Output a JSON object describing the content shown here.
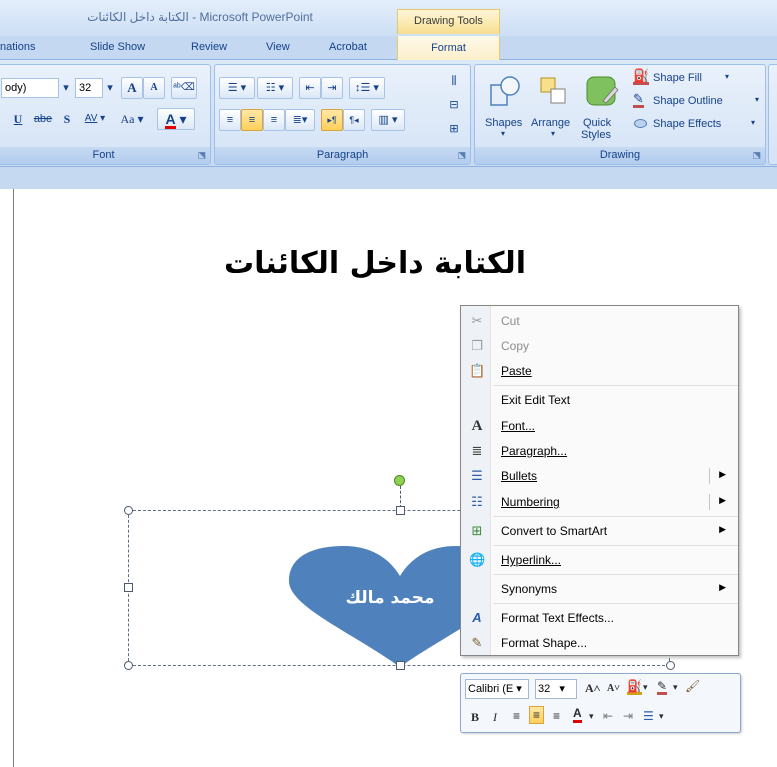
{
  "titlebar": {
    "title": "الكتابة داخل الكائنات - Microsoft PowerPoint",
    "contextual_header": "Drawing Tools"
  },
  "tabs": [
    {
      "label": "nations"
    },
    {
      "label": "Slide Show"
    },
    {
      "label": "Review"
    },
    {
      "label": "View"
    },
    {
      "label": "Acrobat"
    },
    {
      "label": "Format"
    }
  ],
  "ribbon": {
    "font": {
      "label": "Font",
      "font_name": "ody)",
      "font_size": "32",
      "grow": "A",
      "shrink": "A",
      "underline": "U",
      "strike": "abe",
      "shadow": "S",
      "spacing": "AV",
      "case": "Aa",
      "color": "A"
    },
    "paragraph": {
      "label": "Paragraph"
    },
    "drawing": {
      "label": "Drawing",
      "shapes": "Shapes",
      "arrange": "Arrange",
      "quick_styles_1": "Quick",
      "quick_styles_2": "Styles",
      "shape_fill": "Shape Fill",
      "shape_outline": "Shape Outline",
      "shape_effects": "Shape Effects"
    }
  },
  "slide": {
    "title": "الكتابة داخل الكائنات",
    "heart_text": "محمد مالك",
    "heart_color": "#4f81bd"
  },
  "context_menu": [
    {
      "label": "Cut",
      "hotkey_idx": 2,
      "disabled": true
    },
    {
      "label": "Copy",
      "disabled": true
    },
    {
      "label": "Paste"
    },
    {
      "label": "Exit Edit Text"
    },
    {
      "label": "Font..."
    },
    {
      "label": "Paragraph..."
    },
    {
      "label": "Bullets"
    },
    {
      "label": "Numbering"
    },
    {
      "label": "Convert to SmartArt"
    },
    {
      "label": "Hyperlink..."
    },
    {
      "label": "Synonyms"
    },
    {
      "label": "Format Text Effects..."
    },
    {
      "label": "Format Shape..."
    }
  ],
  "mini_toolbar": {
    "font_name": "Calibri (E",
    "font_size": "32"
  }
}
